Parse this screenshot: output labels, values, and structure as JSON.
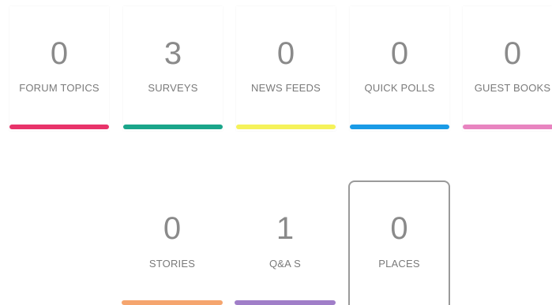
{
  "tiles": [
    {
      "label": "FORUM TOPICS",
      "count": "0",
      "color": "#e8336a"
    },
    {
      "label": "SURVEYS",
      "count": "3",
      "color": "#1aa58a"
    },
    {
      "label": "NEWS FEEDS",
      "count": "0",
      "color": "#f5f25a"
    },
    {
      "label": "QUICK POLLS",
      "count": "0",
      "color": "#1a9be6"
    },
    {
      "label": "GUEST BOOKS",
      "count": "0",
      "color": "#e884c0"
    },
    {
      "label": "STORIES",
      "count": "0",
      "color": "#f5a56e"
    },
    {
      "label": "Q&A S",
      "count": "1",
      "color": "#a07ec8"
    },
    {
      "label": "PLACES",
      "count": "0",
      "color": "",
      "selected": true
    }
  ]
}
